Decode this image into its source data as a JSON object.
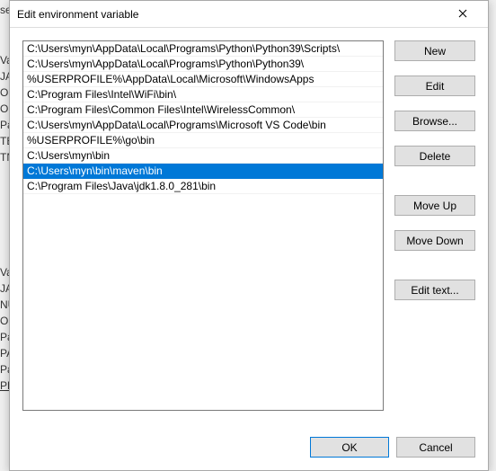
{
  "dialog": {
    "title": "Edit environment variable",
    "close_label": "Close"
  },
  "paths": [
    "C:\\Users\\myn\\AppData\\Local\\Programs\\Python\\Python39\\Scripts\\",
    "C:\\Users\\myn\\AppData\\Local\\Programs\\Python\\Python39\\",
    "%USERPROFILE%\\AppData\\Local\\Microsoft\\WindowsApps",
    "C:\\Program Files\\Intel\\WiFi\\bin\\",
    "C:\\Program Files\\Common Files\\Intel\\WirelessCommon\\",
    "C:\\Users\\myn\\AppData\\Local\\Programs\\Microsoft VS Code\\bin",
    "%USERPROFILE%\\go\\bin",
    "C:\\Users\\myn\\bin",
    "C:\\Users\\myn\\bin\\maven\\bin",
    "C:\\Program Files\\Java\\jdk1.8.0_281\\bin"
  ],
  "selected_index": 8,
  "buttons": {
    "new": "New",
    "edit": "Edit",
    "browse": "Browse...",
    "delete": "Delete",
    "move_up": "Move Up",
    "move_down": "Move Down",
    "edit_text": "Edit text...",
    "ok": "OK",
    "cancel": "Cancel"
  },
  "bg_fragments": {
    "l0": "ser",
    "l1": "Va",
    "l2": "JA",
    "l3": "Or",
    "l4": "Or",
    "l5": "Pa",
    "l6": "TE",
    "l7": "TN",
    "s1": "Va",
    "s2": "JA",
    "s3": "NU",
    "s4": "OS",
    "s5": "Pa",
    "s6": "PA",
    "s7": "Pa",
    "s8": "PR"
  }
}
